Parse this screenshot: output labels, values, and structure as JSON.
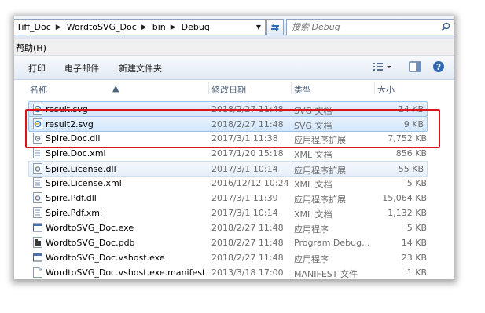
{
  "breadcrumb": [
    "Tiff_Doc",
    "WordtoSVG_Doc",
    "bin",
    "Debug"
  ],
  "search": {
    "placeholder": "搜索 Debug"
  },
  "menu": {
    "help": "帮助(H)"
  },
  "toolbar": {
    "print": "打印",
    "email": "电子邮件",
    "new_folder": "新建文件夹"
  },
  "columns": {
    "name": "名称",
    "date": "修改日期",
    "type": "类型",
    "size": "大小"
  },
  "files": [
    {
      "name": "result.svg",
      "date": "2018/2/27 11:48",
      "type": "SVG 文档",
      "size": "14 KB",
      "icon": "svg-file-icon",
      "selected": true
    },
    {
      "name": "result2.svg",
      "date": "2018/2/27 11:48",
      "type": "SVG 文档",
      "size": "9 KB",
      "icon": "svg-file-icon",
      "selected": true
    },
    {
      "name": "Spire.Doc.dll",
      "date": "2017/3/1 11:38",
      "type": "应用程序扩展",
      "size": "7,752 KB",
      "icon": "dll-file-icon"
    },
    {
      "name": "Spire.Doc.xml",
      "date": "2017/1/20 15:18",
      "type": "XML 文档",
      "size": "856 KB",
      "icon": "xml-file-icon"
    },
    {
      "name": "Spire.License.dll",
      "date": "2017/3/1 10:14",
      "type": "应用程序扩展",
      "size": "55 KB",
      "icon": "dll-file-icon"
    },
    {
      "name": "Spire.License.xml",
      "date": "2016/12/12 10:24",
      "type": "XML 文档",
      "size": "5 KB",
      "icon": "xml-file-icon"
    },
    {
      "name": "Spire.Pdf.dll",
      "date": "2017/3/1 11:39",
      "type": "应用程序扩展",
      "size": "15,064 KB",
      "icon": "dll-file-icon"
    },
    {
      "name": "Spire.Pdf.xml",
      "date": "2017/3/1 10:14",
      "type": "XML 文档",
      "size": "1,132 KB",
      "icon": "xml-file-icon"
    },
    {
      "name": "WordtoSVG_Doc.exe",
      "date": "2018/2/27 11:48",
      "type": "应用程序",
      "size": "5 KB",
      "icon": "exe-file-icon"
    },
    {
      "name": "WordtoSVG_Doc.pdb",
      "date": "2018/2/27 11:48",
      "type": "Program Debug...",
      "size": "14 KB",
      "icon": "pdb-file-icon"
    },
    {
      "name": "WordtoSVG_Doc.vshost.exe",
      "date": "2018/2/27 11:48",
      "type": "应用程序",
      "size": "23 KB",
      "icon": "exe-file-icon"
    },
    {
      "name": "WordtoSVG_Doc.vshost.exe.manifest",
      "date": "2013/3/18 17:00",
      "type": "MANIFEST 文件",
      "size": "1 KB",
      "icon": "manifest-file-icon"
    }
  ],
  "colors": {
    "highlight_border": "#d9141b",
    "selection": "#d3e6fb",
    "header_text": "#4c607a"
  }
}
